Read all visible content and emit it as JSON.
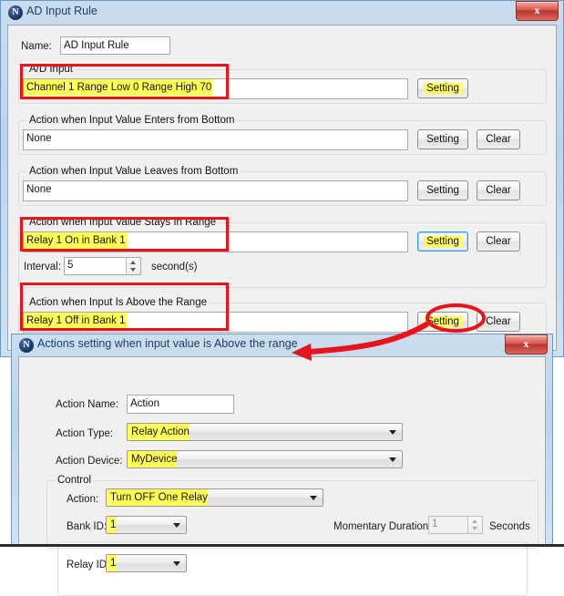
{
  "main_window": {
    "title": "AD Input Rule",
    "icon": "app-n-icon",
    "close_label": "x",
    "name_label": "Name:",
    "name_value": "AD Input Rule",
    "sections": [
      {
        "title": "A/D Input",
        "value": "Channel 1  Range Low 0  Range High 70",
        "setting_label": "Setting",
        "clear_label": ""
      },
      {
        "title": "Action when Input Value Enters from Bottom",
        "value": "None",
        "setting_label": "Setting",
        "clear_label": "Clear"
      },
      {
        "title": "Action when Input Value Leaves from Bottom",
        "value": "None",
        "setting_label": "Setting",
        "clear_label": "Clear"
      },
      {
        "title": "Action when Input Value Stays In Range",
        "value": "Relay 1 On in Bank 1",
        "setting_label": "Setting",
        "clear_label": "Clear",
        "interval_label": "Interval:",
        "interval_value": "5",
        "interval_units": "second(s)"
      },
      {
        "title": "Action when Input Is Above the Range",
        "value": "Relay 1 Off in Bank 1",
        "setting_label": "Setting",
        "clear_label": "Clear"
      }
    ]
  },
  "sub_window": {
    "title": "Actions setting when input value is Above the range",
    "icon": "app-n-icon",
    "close_label": "x",
    "action_name_label": "Action Name:",
    "action_name_value": "Action",
    "action_type_label": "Action Type:",
    "action_type_value": "Relay Action",
    "action_device_label": "Action Device:",
    "action_device_value": "MyDevice",
    "control_group_title": "Control",
    "action_label": "Action:",
    "action_value": "Turn OFF One Relay",
    "bank_id_label": "Bank ID:",
    "bank_id_value": "1",
    "momentary_label": "Momentary Duration:",
    "momentary_value": "1",
    "momentary_units": "Seconds",
    "relay_id_label": "Relay ID:",
    "relay_id_value": "1"
  },
  "annotations": {
    "highlight_color": "#ffff55",
    "marker_color": "#e8131b",
    "ellipse_target": "Setting",
    "arrow_from": "setting-button-above-range",
    "arrow_to": "sub-window-titlebar"
  }
}
